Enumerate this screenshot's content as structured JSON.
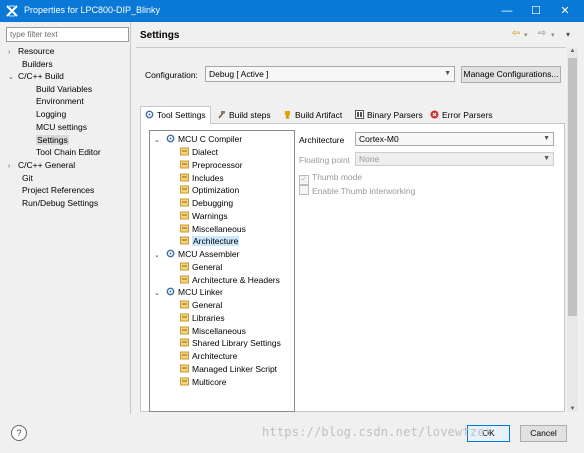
{
  "window": {
    "title": "Properties for LPC800-DIP_Blinky",
    "minimize": "—",
    "maximize": "☐",
    "close": "✕"
  },
  "filter": {
    "placeholder": "type filter text"
  },
  "nav": {
    "items": [
      {
        "label": "Resource",
        "twisty": "›"
      },
      {
        "label": "Builders",
        "twisty": ""
      },
      {
        "label": "C/C++ Build",
        "twisty": "⌄"
      },
      {
        "label": "Build Variables",
        "twisty": ""
      },
      {
        "label": "Environment",
        "twisty": ""
      },
      {
        "label": "Logging",
        "twisty": ""
      },
      {
        "label": "MCU settings",
        "twisty": ""
      },
      {
        "label": "Settings",
        "twisty": ""
      },
      {
        "label": "Tool Chain Editor",
        "twisty": ""
      },
      {
        "label": "C/C++ General",
        "twisty": "›"
      },
      {
        "label": "Git",
        "twisty": ""
      },
      {
        "label": "Project References",
        "twisty": ""
      },
      {
        "label": "Run/Debug Settings",
        "twisty": ""
      }
    ],
    "selected": "Settings"
  },
  "page": {
    "title": "Settings",
    "back": "⇦",
    "forward": "⇨",
    "menu": "▾"
  },
  "configuration": {
    "label": "Configuration:",
    "value": "Debug  [ Active ]",
    "manage_button": "Manage Configurations..."
  },
  "tabs": [
    {
      "label": "Tool Settings",
      "active": true
    },
    {
      "label": "Build steps",
      "active": false
    },
    {
      "label": "Build Artifact",
      "active": false
    },
    {
      "label": "Binary Parsers",
      "active": false
    },
    {
      "label": "Error Parsers",
      "active": false
    }
  ],
  "tree": {
    "groups": [
      {
        "label": "MCU C Compiler",
        "twisty": "⌄",
        "children": [
          "Dialect",
          "Preprocessor",
          "Includes",
          "Optimization",
          "Debugging",
          "Warnings",
          "Miscellaneous",
          "Architecture"
        ]
      },
      {
        "label": "MCU Assembler",
        "twisty": "⌄",
        "children": [
          "General",
          "Architecture & Headers"
        ]
      },
      {
        "label": "MCU Linker",
        "twisty": "⌄",
        "children": [
          "General",
          "Libraries",
          "Miscellaneous",
          "Shared Library Settings",
          "Architecture",
          "Managed Linker Script",
          "Multicore"
        ]
      }
    ],
    "selected": "Architecture"
  },
  "properties": {
    "architecture": {
      "label": "Architecture",
      "value": "Cortex-M0"
    },
    "floating_point": {
      "label": "Floating point",
      "value": "None"
    },
    "thumb_mode": {
      "label": "Thumb mode",
      "checked": true
    },
    "thumb_interworking": {
      "label": "Enable Thumb interworking",
      "checked": false
    }
  },
  "footer": {
    "help": "?",
    "ok": "OK",
    "cancel": "Cancel",
    "watermark": "https://blog.csdn.net/lovewtzer"
  },
  "colors": {
    "titlebar": "#0a78d7",
    "selection": "#cce8ff",
    "ok_border": "#0078d7"
  }
}
